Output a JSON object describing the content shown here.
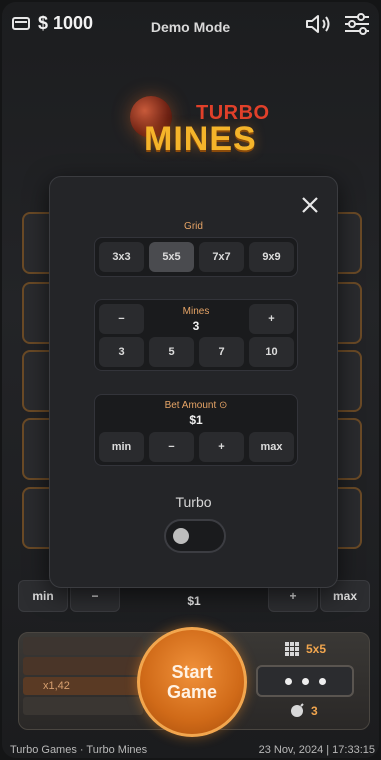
{
  "topbar": {
    "balance": "$ 1000",
    "mode": "Demo Mode"
  },
  "logo": {
    "turbo": "TURBO",
    "mines": "MINES"
  },
  "bet_bar": {
    "min": "min",
    "minus": "−",
    "amount_label": "Bet Amount",
    "amount": "$1",
    "plus": "+",
    "max": "max"
  },
  "game_panel": {
    "multipliers": [
      "x1,42"
    ],
    "start": "Start Game",
    "grid_size": "5x5",
    "mines_count": "3"
  },
  "footer": {
    "left": "Turbo Games · Turbo Mines",
    "right": "23 Nov, 2024 | 17:33:15"
  },
  "modal": {
    "grid_label": "Grid",
    "grid_options": [
      "3x3",
      "5x5",
      "7x7",
      "9x9"
    ],
    "grid_selected": "5x5",
    "mines_label": "Mines",
    "mines_value": "3",
    "mines_minus": "−",
    "mines_plus": "+",
    "mines_presets": [
      "3",
      "5",
      "7",
      "10"
    ],
    "bet_label": "Bet Amount ⊙",
    "bet_value": "$1",
    "bet_min": "min",
    "bet_minus": "−",
    "bet_plus": "+",
    "bet_max": "max",
    "turbo_label": "Turbo",
    "turbo_on": false
  },
  "colors": {
    "accent": "#f2a64e",
    "label": "#e6a466"
  }
}
